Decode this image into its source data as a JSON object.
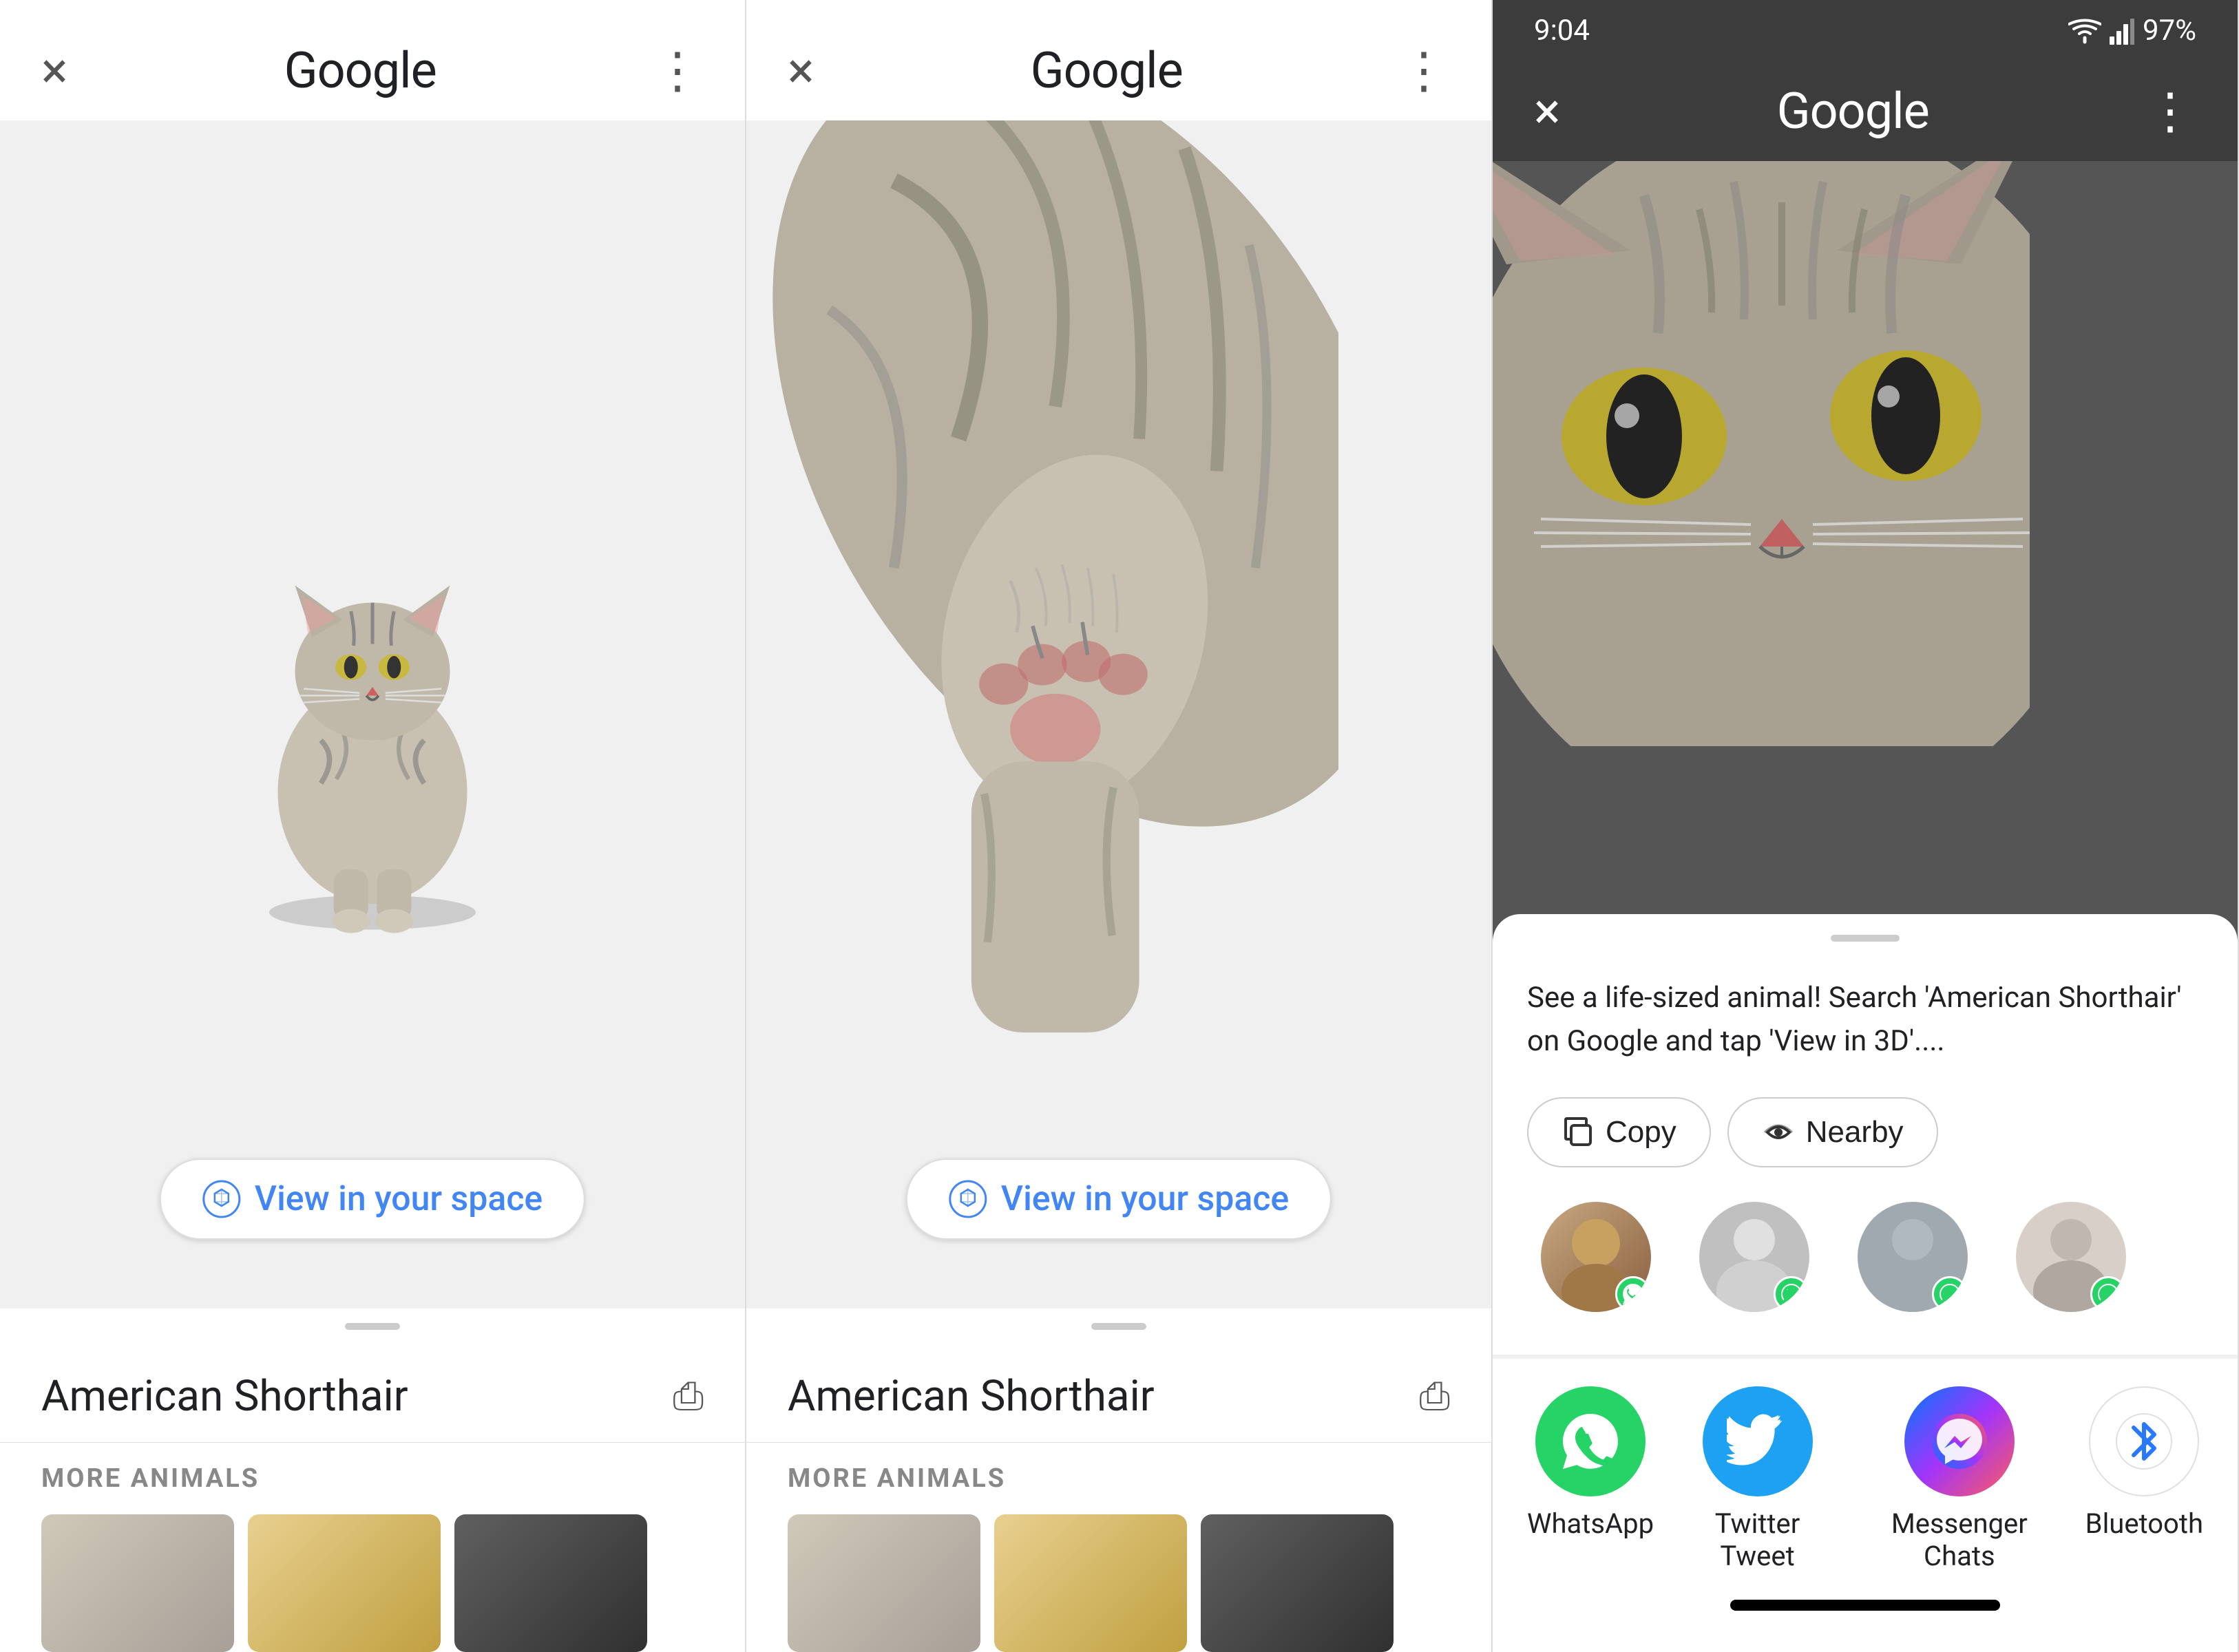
{
  "panels": [
    {
      "id": "panel1",
      "header": {
        "close_label": "×",
        "title": "Google",
        "menu_label": "⋮"
      },
      "animal_name": "American Shorthair",
      "view_space_label": "View in your space",
      "more_animals_label": "MORE ANIMALS",
      "scroll_indicator": true
    },
    {
      "id": "panel2",
      "header": {
        "close_label": "×",
        "title": "Google",
        "menu_label": "⋮"
      },
      "animal_name": "American Shorthair",
      "view_space_label": "View in your space",
      "more_animals_label": "MORE ANIMALS",
      "scroll_indicator": true
    },
    {
      "id": "panel3",
      "status_bar": {
        "time": "9:04",
        "battery": "97%"
      },
      "header": {
        "close_label": "×",
        "title": "Google",
        "menu_label": "⋮"
      },
      "share_sheet": {
        "share_text": "See a life-sized animal! Search 'American Shorthair' on Google and tap 'View in 3D'....",
        "copy_label": "Copy",
        "nearby_label": "Nearby",
        "contacts": [
          {
            "name": "",
            "type": "has-image"
          },
          {
            "name": "",
            "type": "grey1"
          },
          {
            "name": "",
            "type": "grey2"
          },
          {
            "name": "",
            "type": "grey3"
          }
        ],
        "apps": [
          {
            "id": "whatsapp",
            "label": "WhatsApp",
            "icon_color": "whatsapp"
          },
          {
            "id": "twitter",
            "label": "Twitter Tweet",
            "icon_color": "twitter"
          },
          {
            "id": "messenger",
            "label": "Messenger Chats",
            "icon_color": "messenger"
          },
          {
            "id": "bluetooth",
            "label": "Bluetooth",
            "icon_color": "bluetooth"
          }
        ]
      }
    }
  ]
}
